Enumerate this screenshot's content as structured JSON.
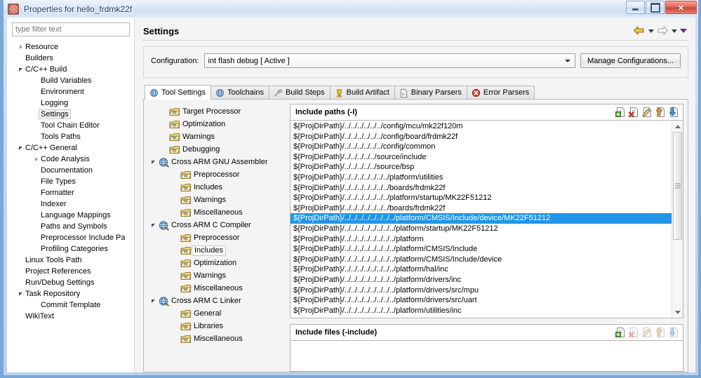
{
  "window": {
    "title": "Properties for hello_frdmk22f",
    "app_icon": "properties-icon",
    "buttons": {
      "minimize": "minimize-button",
      "maximize": "restore-button",
      "close": "×"
    }
  },
  "sidebar": {
    "filter": {
      "placeholder": "type filter text",
      "value": ""
    },
    "items": [
      {
        "label": "Resource",
        "indent": 0,
        "arrow": "collapsed",
        "selected": false
      },
      {
        "label": "Builders",
        "indent": 0,
        "arrow": "none",
        "selected": false
      },
      {
        "label": "C/C++ Build",
        "indent": 0,
        "arrow": "expanded",
        "selected": false
      },
      {
        "label": "Build Variables",
        "indent": 1,
        "arrow": "none",
        "selected": false
      },
      {
        "label": "Environment",
        "indent": 1,
        "arrow": "none",
        "selected": false
      },
      {
        "label": "Logging",
        "indent": 1,
        "arrow": "none",
        "selected": false
      },
      {
        "label": "Settings",
        "indent": 1,
        "arrow": "none",
        "selected": true
      },
      {
        "label": "Tool Chain Editor",
        "indent": 1,
        "arrow": "none",
        "selected": false
      },
      {
        "label": "Tools Paths",
        "indent": 1,
        "arrow": "none",
        "selected": false
      },
      {
        "label": "C/C++ General",
        "indent": 0,
        "arrow": "expanded",
        "selected": false
      },
      {
        "label": "Code Analysis",
        "indent": 1,
        "arrow": "collapsed",
        "selected": false
      },
      {
        "label": "Documentation",
        "indent": 1,
        "arrow": "none",
        "selected": false
      },
      {
        "label": "File Types",
        "indent": 1,
        "arrow": "none",
        "selected": false
      },
      {
        "label": "Formatter",
        "indent": 1,
        "arrow": "none",
        "selected": false
      },
      {
        "label": "Indexer",
        "indent": 1,
        "arrow": "none",
        "selected": false
      },
      {
        "label": "Language Mappings",
        "indent": 1,
        "arrow": "none",
        "selected": false
      },
      {
        "label": "Paths and Symbols",
        "indent": 1,
        "arrow": "none",
        "selected": false
      },
      {
        "label": "Preprocessor Include Pa",
        "indent": 1,
        "arrow": "none",
        "selected": false
      },
      {
        "label": "Profiling Categories",
        "indent": 1,
        "arrow": "none",
        "selected": false
      },
      {
        "label": "Linux Tools Path",
        "indent": 0,
        "arrow": "none",
        "selected": false
      },
      {
        "label": "Project References",
        "indent": 0,
        "arrow": "none",
        "selected": false
      },
      {
        "label": "Run/Debug Settings",
        "indent": 0,
        "arrow": "none",
        "selected": false
      },
      {
        "label": "Task Repository",
        "indent": 0,
        "arrow": "expanded",
        "selected": false
      },
      {
        "label": "Commit Template",
        "indent": 1,
        "arrow": "none",
        "selected": false
      },
      {
        "label": "WikiText",
        "indent": 0,
        "arrow": "none",
        "selected": false
      }
    ]
  },
  "page": {
    "title": "Settings",
    "nav": {
      "back": "back-arrow-icon",
      "back_menu": "back-dropdown-icon",
      "forward": "forward-arrow-icon",
      "forward_menu": "forward-dropdown-icon",
      "view_menu": "view-menu-icon"
    }
  },
  "configuration": {
    "label": "Configuration:",
    "value": "int flash debug  [ Active ]",
    "manage_button": "Manage Configurations..."
  },
  "tabs": [
    {
      "label": "Tool Settings",
      "icon": "gear-globe-icon",
      "active": true
    },
    {
      "label": "Toolchains",
      "icon": "gear-globe-icon",
      "active": false
    },
    {
      "label": "Build Steps",
      "icon": "hammer-icon",
      "active": false
    },
    {
      "label": "Build Artifact",
      "icon": "trophy-icon",
      "active": false
    },
    {
      "label": "Binary Parsers",
      "icon": "binary-file-icon",
      "active": false
    },
    {
      "label": "Error Parsers",
      "icon": "error-circle-icon",
      "active": false
    }
  ],
  "tool_tree": [
    {
      "label": "Target Processor",
      "indent": 1,
      "icon": "folder-icon",
      "arrow": "none",
      "selected": false
    },
    {
      "label": "Optimization",
      "indent": 1,
      "icon": "folder-icon",
      "arrow": "none",
      "selected": false
    },
    {
      "label": "Warnings",
      "indent": 1,
      "icon": "folder-icon",
      "arrow": "none",
      "selected": false
    },
    {
      "label": "Debugging",
      "indent": 1,
      "icon": "folder-icon",
      "arrow": "none",
      "selected": false
    },
    {
      "label": "Cross ARM GNU Assembler",
      "indent": 0,
      "icon": "tool-icon",
      "arrow": "expanded",
      "selected": false
    },
    {
      "label": "Preprocessor",
      "indent": 2,
      "icon": "folder-icon",
      "arrow": "none",
      "selected": false
    },
    {
      "label": "Includes",
      "indent": 2,
      "icon": "folder-icon",
      "arrow": "none",
      "selected": false
    },
    {
      "label": "Warnings",
      "indent": 2,
      "icon": "folder-icon",
      "arrow": "none",
      "selected": false
    },
    {
      "label": "Miscellaneous",
      "indent": 2,
      "icon": "folder-icon",
      "arrow": "none",
      "selected": false
    },
    {
      "label": "Cross ARM C Compiler",
      "indent": 0,
      "icon": "tool-icon",
      "arrow": "expanded",
      "selected": false
    },
    {
      "label": "Preprocessor",
      "indent": 2,
      "icon": "folder-icon",
      "arrow": "none",
      "selected": false
    },
    {
      "label": "Includes",
      "indent": 2,
      "icon": "folder-icon",
      "arrow": "none",
      "selected": true
    },
    {
      "label": "Optimization",
      "indent": 2,
      "icon": "folder-icon",
      "arrow": "none",
      "selected": false
    },
    {
      "label": "Warnings",
      "indent": 2,
      "icon": "folder-icon",
      "arrow": "none",
      "selected": false
    },
    {
      "label": "Miscellaneous",
      "indent": 2,
      "icon": "folder-icon",
      "arrow": "none",
      "selected": false
    },
    {
      "label": "Cross ARM C Linker",
      "indent": 0,
      "icon": "tool-icon",
      "arrow": "expanded",
      "selected": false
    },
    {
      "label": "General",
      "indent": 2,
      "icon": "folder-icon",
      "arrow": "none",
      "selected": false
    },
    {
      "label": "Libraries",
      "indent": 2,
      "icon": "folder-icon",
      "arrow": "none",
      "selected": false
    },
    {
      "label": "Miscellaneous",
      "indent": 2,
      "icon": "folder-icon",
      "arrow": "none",
      "selected": false
    }
  ],
  "include_paths": {
    "title": "Include paths (-I)",
    "toolbar": [
      {
        "name": "add-icon",
        "enabled": true
      },
      {
        "name": "delete-icon",
        "enabled": true
      },
      {
        "name": "edit-icon",
        "enabled": true
      },
      {
        "name": "move-up-icon",
        "enabled": true
      },
      {
        "name": "move-down-icon",
        "enabled": true
      }
    ],
    "rows": [
      {
        "text": "${ProjDirPath}/../../../../../../config/mcu/mk22f120m",
        "selected": false
      },
      {
        "text": "${ProjDirPath}/../../../../../../config/board/frdmk22f",
        "selected": false
      },
      {
        "text": "${ProjDirPath}/../../../../../../config/common",
        "selected": false
      },
      {
        "text": "${ProjDirPath}/../../../../../source/include",
        "selected": false
      },
      {
        "text": "${ProjDirPath}/../../../../../source/bsp",
        "selected": false
      },
      {
        "text": "${ProjDirPath}/../../../../../../../platform/utilities",
        "selected": false
      },
      {
        "text": "${ProjDirPath}/../../../../../../../boards/frdmk22f",
        "selected": false
      },
      {
        "text": "${ProjDirPath}/../../../../../../../platform/startup/MK22F51212",
        "selected": false
      },
      {
        "text": "${ProjDirPath}/../../../../../../../boards/frdmk22f",
        "selected": false
      },
      {
        "text": "${ProjDirPath}/../../../../../../../../platform/CMSIS/Include/device/MK22F51212",
        "selected": true
      },
      {
        "text": "${ProjDirPath}/../../../../../../../../platform/startup/MK22F51212",
        "selected": false
      },
      {
        "text": "${ProjDirPath}/../../../../../../../../platform",
        "selected": false
      },
      {
        "text": "${ProjDirPath}/../../../../../../../../platform/CMSIS/Include",
        "selected": false
      },
      {
        "text": "${ProjDirPath}/../../../../../../../../platform/CMSIS/Include/device",
        "selected": false
      },
      {
        "text": "${ProjDirPath}/../../../../../../../../platform/hal/inc",
        "selected": false
      },
      {
        "text": "${ProjDirPath}/../../../../../../../../platform/drivers/inc",
        "selected": false
      },
      {
        "text": "${ProjDirPath}/../../../../../../../../platform/drivers/src/mpu",
        "selected": false
      },
      {
        "text": "${ProjDirPath}/../../../../../../../../platform/drivers/src/uart",
        "selected": false
      },
      {
        "text": "${ProjDirPath}/../../../../../../../../platform/utilities/inc",
        "selected": false
      }
    ]
  },
  "include_files": {
    "title": "Include files (-include)",
    "toolbar": [
      {
        "name": "add-icon",
        "enabled": true
      },
      {
        "name": "delete-icon",
        "enabled": false
      },
      {
        "name": "edit-icon",
        "enabled": false
      },
      {
        "name": "move-up-icon",
        "enabled": false
      },
      {
        "name": "move-down-icon",
        "enabled": false
      }
    ],
    "rows": []
  },
  "colors": {
    "selection": "#2196e8",
    "title_text": "#1b3b63",
    "close_button": "#cc4338"
  }
}
